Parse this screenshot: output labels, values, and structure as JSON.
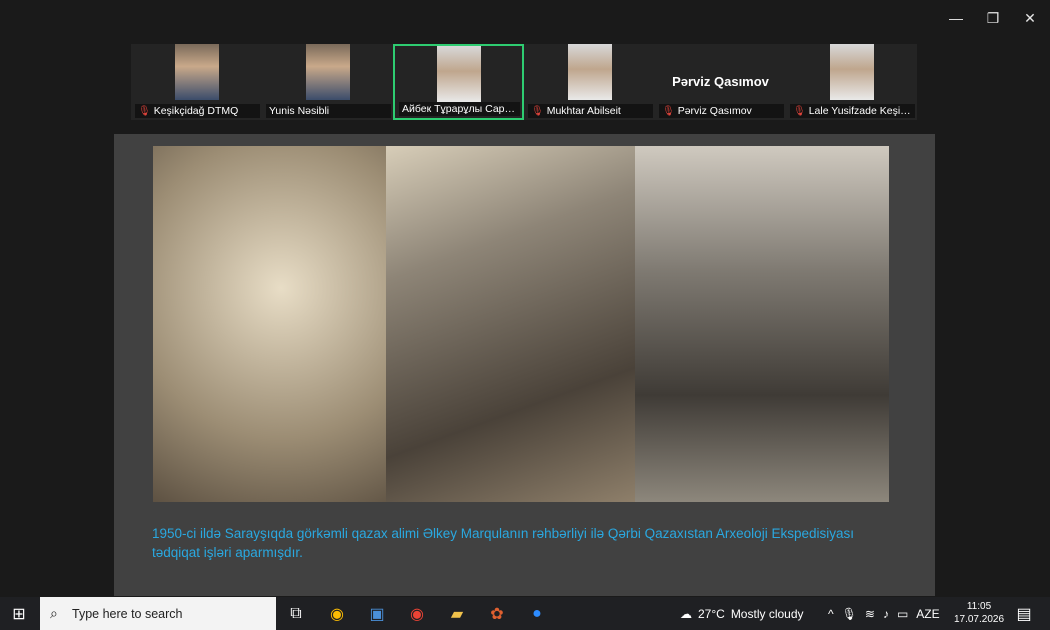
{
  "window": {
    "minimize": "—",
    "restore": "❐",
    "close": "✕"
  },
  "participants": [
    {
      "name": "Keşikçidağ DTMQ",
      "muted": true
    },
    {
      "name": "Yunis Nəsibli",
      "muted": false
    },
    {
      "name": "Айбек Тұрарұлы Сарай...",
      "muted": false,
      "active": true
    },
    {
      "name": "Mukhtar Abilseit",
      "muted": true
    },
    {
      "name": "Pərviz Qasımov",
      "muted": true,
      "display_name": "Pərviz Qasımov"
    },
    {
      "name": "Lale Yusifzade Keşikçi...",
      "muted": true
    }
  ],
  "slide": {
    "caption": "1950-ci ildə Sarayşıqda görkəmli qazax alimi Əlkey Marqulanın rəhbərliyi ilə Qərbi Qazaxıstan Arxeoloji Ekspedisiyası tədqiqat işləri aparmışdır."
  },
  "taskbar": {
    "search_placeholder": "Type here to search",
    "weather_temp": "27°C",
    "weather_text": "Mostly cloudy",
    "lang": "AZE",
    "time": "11:05",
    "date": "17.07.2026"
  }
}
